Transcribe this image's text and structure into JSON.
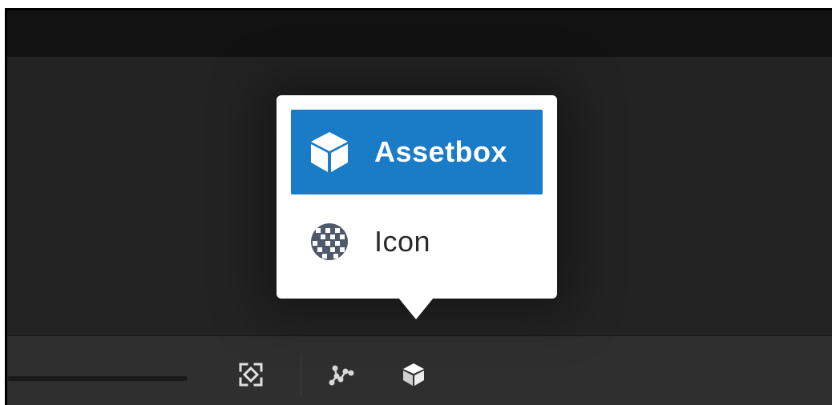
{
  "popup": {
    "items": [
      {
        "label": "Assetbox",
        "icon": "cube-icon",
        "active": true
      },
      {
        "label": "Icon",
        "icon": "pattern-globe-icon",
        "active": false
      }
    ]
  },
  "toolbar": {
    "buttons": [
      {
        "icon": "focus-frame-icon"
      },
      {
        "icon": "node-graph-icon"
      },
      {
        "icon": "cube-icon"
      }
    ]
  },
  "colors": {
    "accent": "#1a7bc6",
    "background": "#232323",
    "topbar": "#121212",
    "bottombar": "#2f2f2f"
  }
}
